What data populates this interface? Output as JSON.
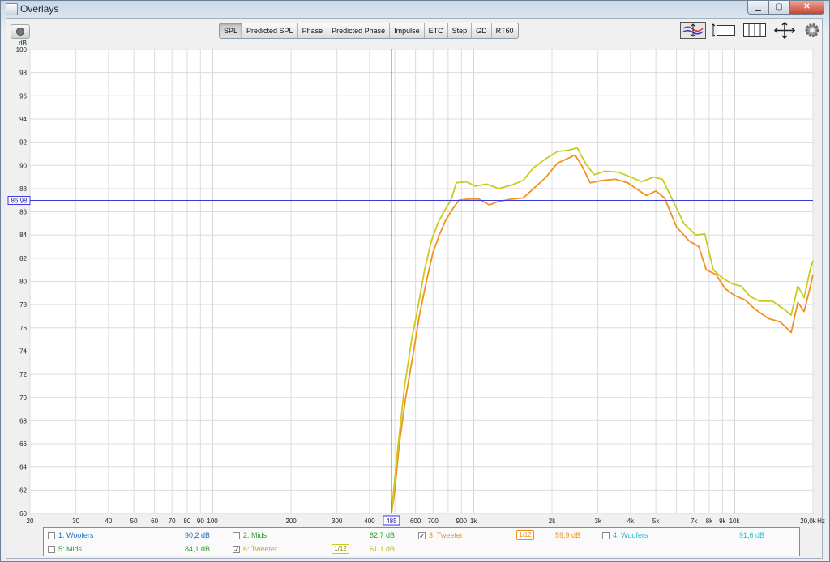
{
  "window": {
    "title": "Overlays"
  },
  "tabs": [
    {
      "label": "SPL",
      "active": true
    },
    {
      "label": "Predicted SPL",
      "active": false
    },
    {
      "label": "Phase",
      "active": false
    },
    {
      "label": "Predicted Phase",
      "active": false
    },
    {
      "label": "Impulse",
      "active": false
    },
    {
      "label": "ETC",
      "active": false
    },
    {
      "label": "Step",
      "active": false
    },
    {
      "label": "GD",
      "active": false
    },
    {
      "label": "RT60",
      "active": false
    }
  ],
  "cursor": {
    "y_readout": "86,98",
    "x_readout": "485"
  },
  "legend": [
    {
      "label": "1: Woofers",
      "value": "90,2 dB",
      "checked": false,
      "color": "#1f6fb8"
    },
    {
      "label": "2: Mids",
      "value": "82,7 dB",
      "checked": false,
      "color": "#2e9d2e"
    },
    {
      "label": "3: Tweeter",
      "value": "59,9 dB",
      "checked": true,
      "color": "#f08c1e",
      "smoothing": "1/12"
    },
    {
      "label": "4: Woofers",
      "value": "91,6 dB",
      "checked": false,
      "color": "#2bb7c8"
    },
    {
      "label": "5: Mids",
      "value": "84,1 dB",
      "checked": false,
      "color": "#2e9d2e"
    },
    {
      "label": "6: Tweeter",
      "value": "61,1 dB",
      "checked": true,
      "color": "#c8c81e",
      "smoothing": "1/12"
    }
  ],
  "chart_data": {
    "type": "line",
    "ylabel": "dB",
    "xlabel": "Hz",
    "x_scale": "log",
    "xlim": [
      20,
      20000
    ],
    "ylim": [
      60,
      100
    ],
    "yticks": [
      60,
      62,
      64,
      66,
      68,
      70,
      72,
      74,
      76,
      78,
      80,
      82,
      84,
      86,
      88,
      90,
      92,
      94,
      96,
      98,
      100
    ],
    "xticks": [
      {
        "v": 20,
        "label": "20"
      },
      {
        "v": 30,
        "label": "30"
      },
      {
        "v": 40,
        "label": "40"
      },
      {
        "v": 50,
        "label": "50"
      },
      {
        "v": 60,
        "label": "60"
      },
      {
        "v": 70,
        "label": "70"
      },
      {
        "v": 80,
        "label": "80"
      },
      {
        "v": 90,
        "label": "90"
      },
      {
        "v": 100,
        "label": "100"
      },
      {
        "v": 200,
        "label": "200"
      },
      {
        "v": 300,
        "label": "300"
      },
      {
        "v": 400,
        "label": "400"
      },
      {
        "v": 600,
        "label": "600"
      },
      {
        "v": 700,
        "label": "700"
      },
      {
        "v": 900,
        "label": "900"
      },
      {
        "v": 1000,
        "label": "1k"
      },
      {
        "v": 2000,
        "label": "2k"
      },
      {
        "v": 3000,
        "label": "3k"
      },
      {
        "v": 4000,
        "label": "4k"
      },
      {
        "v": 5000,
        "label": "5k"
      },
      {
        "v": 7000,
        "label": "7k"
      },
      {
        "v": 8000,
        "label": "8k"
      },
      {
        "v": 9000,
        "label": "9k"
      },
      {
        "v": 10000,
        "label": "10k"
      },
      {
        "v": 20000,
        "label": "20,0k"
      }
    ],
    "cursor": {
      "x": 485,
      "y": 86.98
    },
    "series": [
      {
        "name": "3: Tweeter",
        "color": "#f5901f",
        "points": [
          [
            485,
            60
          ],
          [
            500,
            62
          ],
          [
            520,
            66
          ],
          [
            550,
            70
          ],
          [
            590,
            74
          ],
          [
            620,
            77
          ],
          [
            660,
            80
          ],
          [
            700,
            82.5
          ],
          [
            740,
            84
          ],
          [
            780,
            85.2
          ],
          [
            830,
            86.2
          ],
          [
            880,
            87
          ],
          [
            960,
            87.1
          ],
          [
            1050,
            87.1
          ],
          [
            1150,
            86.6
          ],
          [
            1250,
            86.9
          ],
          [
            1400,
            87.1
          ],
          [
            1550,
            87.2
          ],
          [
            1700,
            88
          ],
          [
            1900,
            89
          ],
          [
            2100,
            90.2
          ],
          [
            2300,
            90.6
          ],
          [
            2450,
            90.9
          ],
          [
            2600,
            90
          ],
          [
            2800,
            88.5
          ],
          [
            3100,
            88.7
          ],
          [
            3500,
            88.8
          ],
          [
            3900,
            88.5
          ],
          [
            4200,
            88
          ],
          [
            4600,
            87.4
          ],
          [
            5000,
            87.8
          ],
          [
            5400,
            87.2
          ],
          [
            6000,
            84.7
          ],
          [
            6700,
            83.5
          ],
          [
            7300,
            83
          ],
          [
            7800,
            81
          ],
          [
            8500,
            80.6
          ],
          [
            9200,
            79.4
          ],
          [
            10000,
            78.8
          ],
          [
            11000,
            78.4
          ],
          [
            12000,
            77.6
          ],
          [
            13500,
            76.8
          ],
          [
            15000,
            76.5
          ],
          [
            16500,
            75.6
          ],
          [
            17500,
            78.2
          ],
          [
            18500,
            77.4
          ],
          [
            19500,
            79.5
          ],
          [
            20000,
            80.6
          ]
        ]
      },
      {
        "name": "6: Tweeter",
        "color": "#c9cc1e",
        "points": [
          [
            485,
            60
          ],
          [
            495,
            62
          ],
          [
            515,
            66
          ],
          [
            545,
            71
          ],
          [
            580,
            75
          ],
          [
            610,
            77.5
          ],
          [
            650,
            81
          ],
          [
            690,
            83.5
          ],
          [
            730,
            85
          ],
          [
            770,
            86
          ],
          [
            820,
            87
          ],
          [
            860,
            88.5
          ],
          [
            940,
            88.6
          ],
          [
            1020,
            88.2
          ],
          [
            1120,
            88.4
          ],
          [
            1250,
            88
          ],
          [
            1400,
            88.3
          ],
          [
            1550,
            88.7
          ],
          [
            1700,
            89.8
          ],
          [
            1900,
            90.6
          ],
          [
            2100,
            91.2
          ],
          [
            2300,
            91.3
          ],
          [
            2500,
            91.5
          ],
          [
            2700,
            90.1
          ],
          [
            2900,
            89.2
          ],
          [
            3200,
            89.5
          ],
          [
            3600,
            89.4
          ],
          [
            4000,
            89
          ],
          [
            4400,
            88.6
          ],
          [
            4900,
            89
          ],
          [
            5300,
            88.8
          ],
          [
            5800,
            87
          ],
          [
            6400,
            85
          ],
          [
            7100,
            84
          ],
          [
            7700,
            84.1
          ],
          [
            8300,
            81
          ],
          [
            9000,
            80.3
          ],
          [
            9800,
            79.8
          ],
          [
            10600,
            79.6
          ],
          [
            11500,
            78.7
          ],
          [
            12500,
            78.3
          ],
          [
            14000,
            78.3
          ],
          [
            15500,
            77.6
          ],
          [
            16500,
            77.1
          ],
          [
            17500,
            79.6
          ],
          [
            18500,
            78.6
          ],
          [
            19500,
            81
          ],
          [
            20000,
            81.8
          ]
        ]
      }
    ]
  }
}
